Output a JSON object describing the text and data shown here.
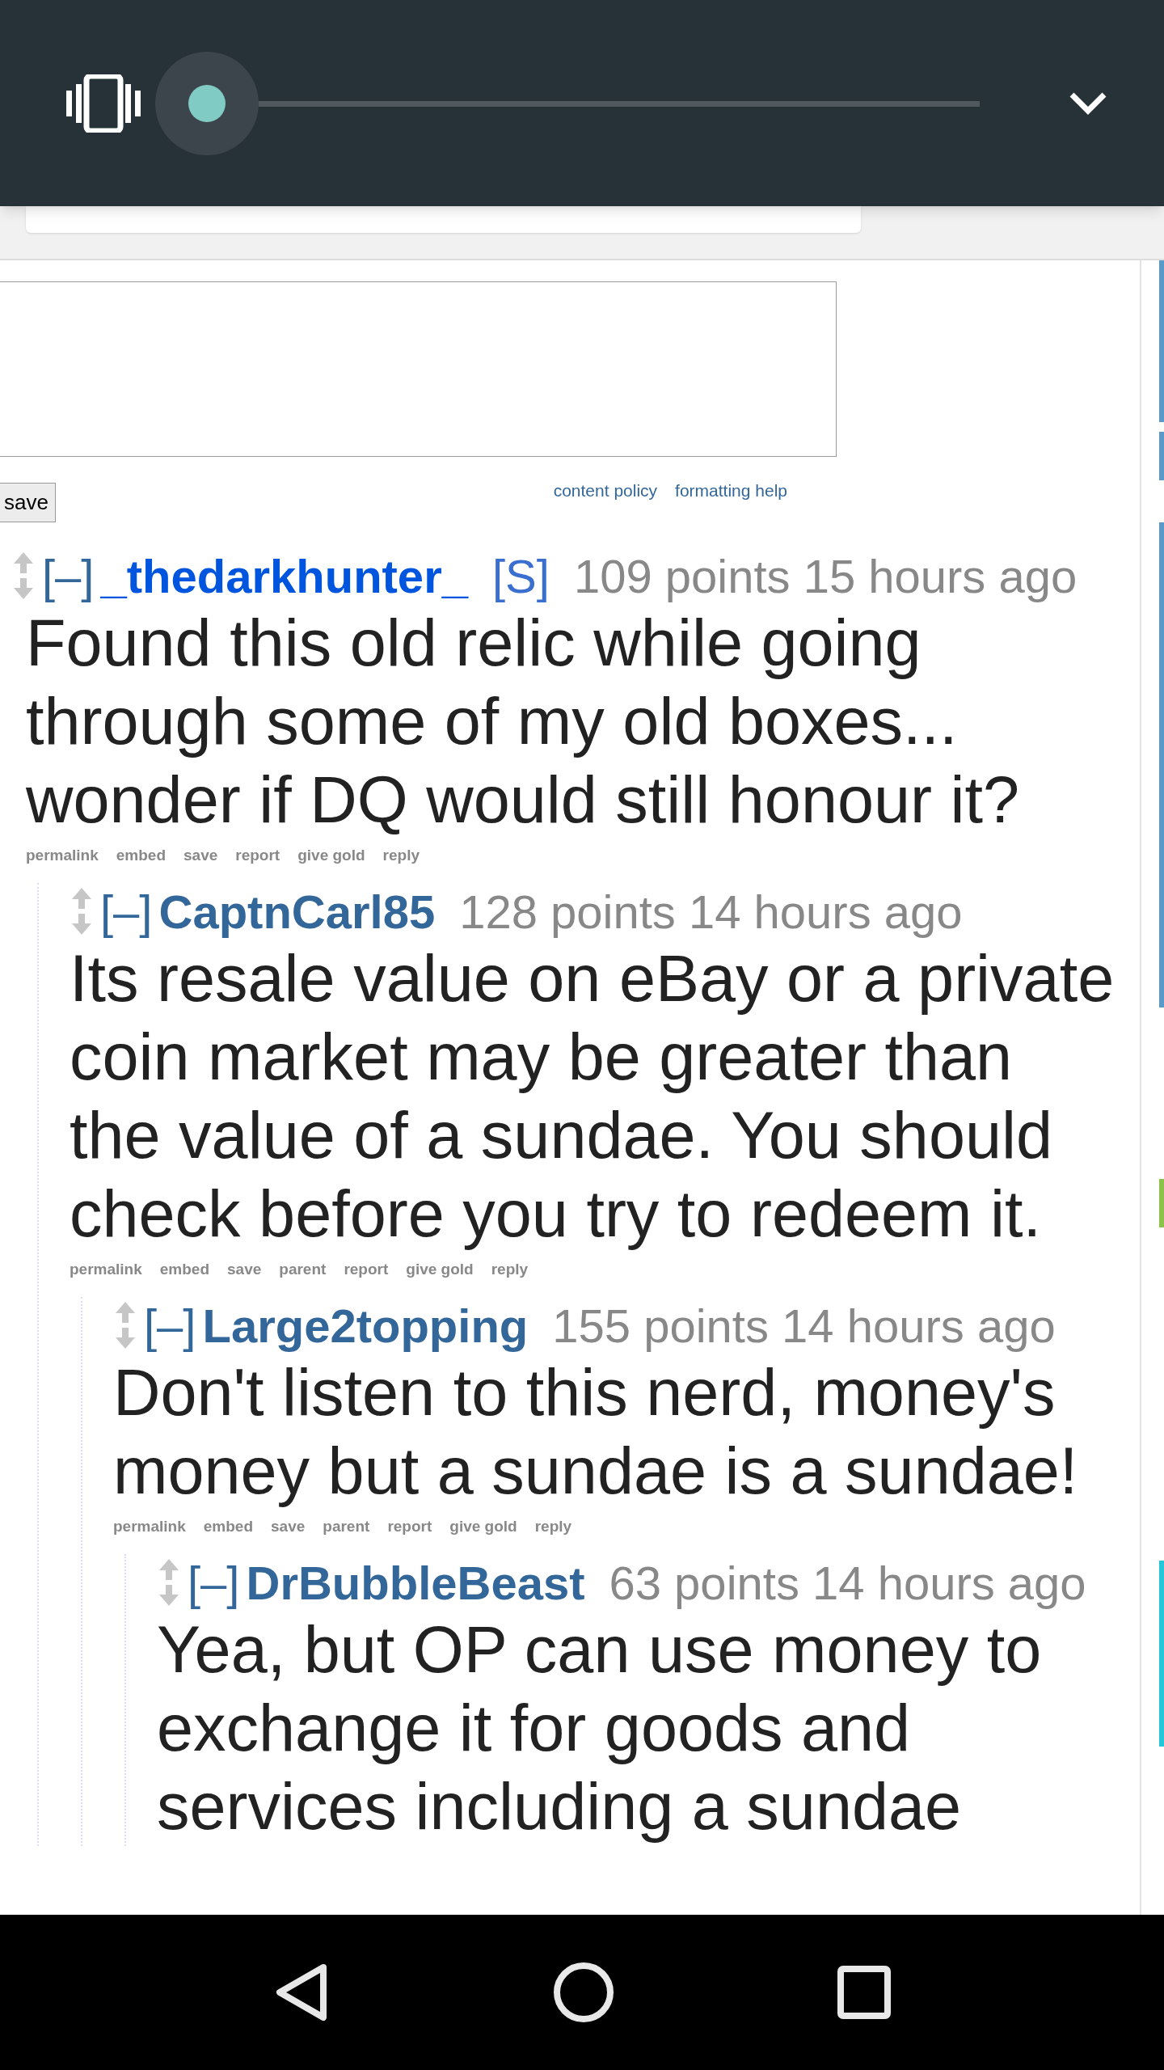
{
  "editor": {
    "save_label": "save",
    "links": [
      "content policy",
      "formatting help"
    ]
  },
  "comments": [
    {
      "collapse": "[–]",
      "author": "_thedarkhunter_",
      "submitter": true,
      "tag": "[S]",
      "meta": "109 points 15 hours ago",
      "body": "Found this old relic while going through some of my old boxes... wonder if DQ would still honour it?",
      "actions": [
        "permalink",
        "embed",
        "save",
        "report",
        "give gold",
        "reply"
      ],
      "children": [
        {
          "collapse": "[–]",
          "author": "CaptnCarl85",
          "submitter": false,
          "meta": "128 points 14 hours ago",
          "body": "Its resale value on eBay or a private coin market may be greater than the value of a sundae. You should check before you try to redeem it.",
          "actions": [
            "permalink",
            "embed",
            "save",
            "parent",
            "report",
            "give gold",
            "reply"
          ],
          "children": [
            {
              "collapse": "[–]",
              "author": "Large2topping",
              "submitter": false,
              "meta": "155 points 14 hours ago",
              "body": "Don't listen to this nerd, money's money but a sundae is a sundae!",
              "actions": [
                "permalink",
                "embed",
                "save",
                "parent",
                "report",
                "give gold",
                "reply"
              ],
              "children": [
                {
                  "collapse": "[–]",
                  "author": "DrBubbleBeast",
                  "submitter": false,
                  "meta": "63 points 14 hours ago",
                  "body": "Yea, but OP can use money to exchange it for goods and services including a sundae"
                }
              ]
            }
          ]
        }
      ]
    }
  ]
}
